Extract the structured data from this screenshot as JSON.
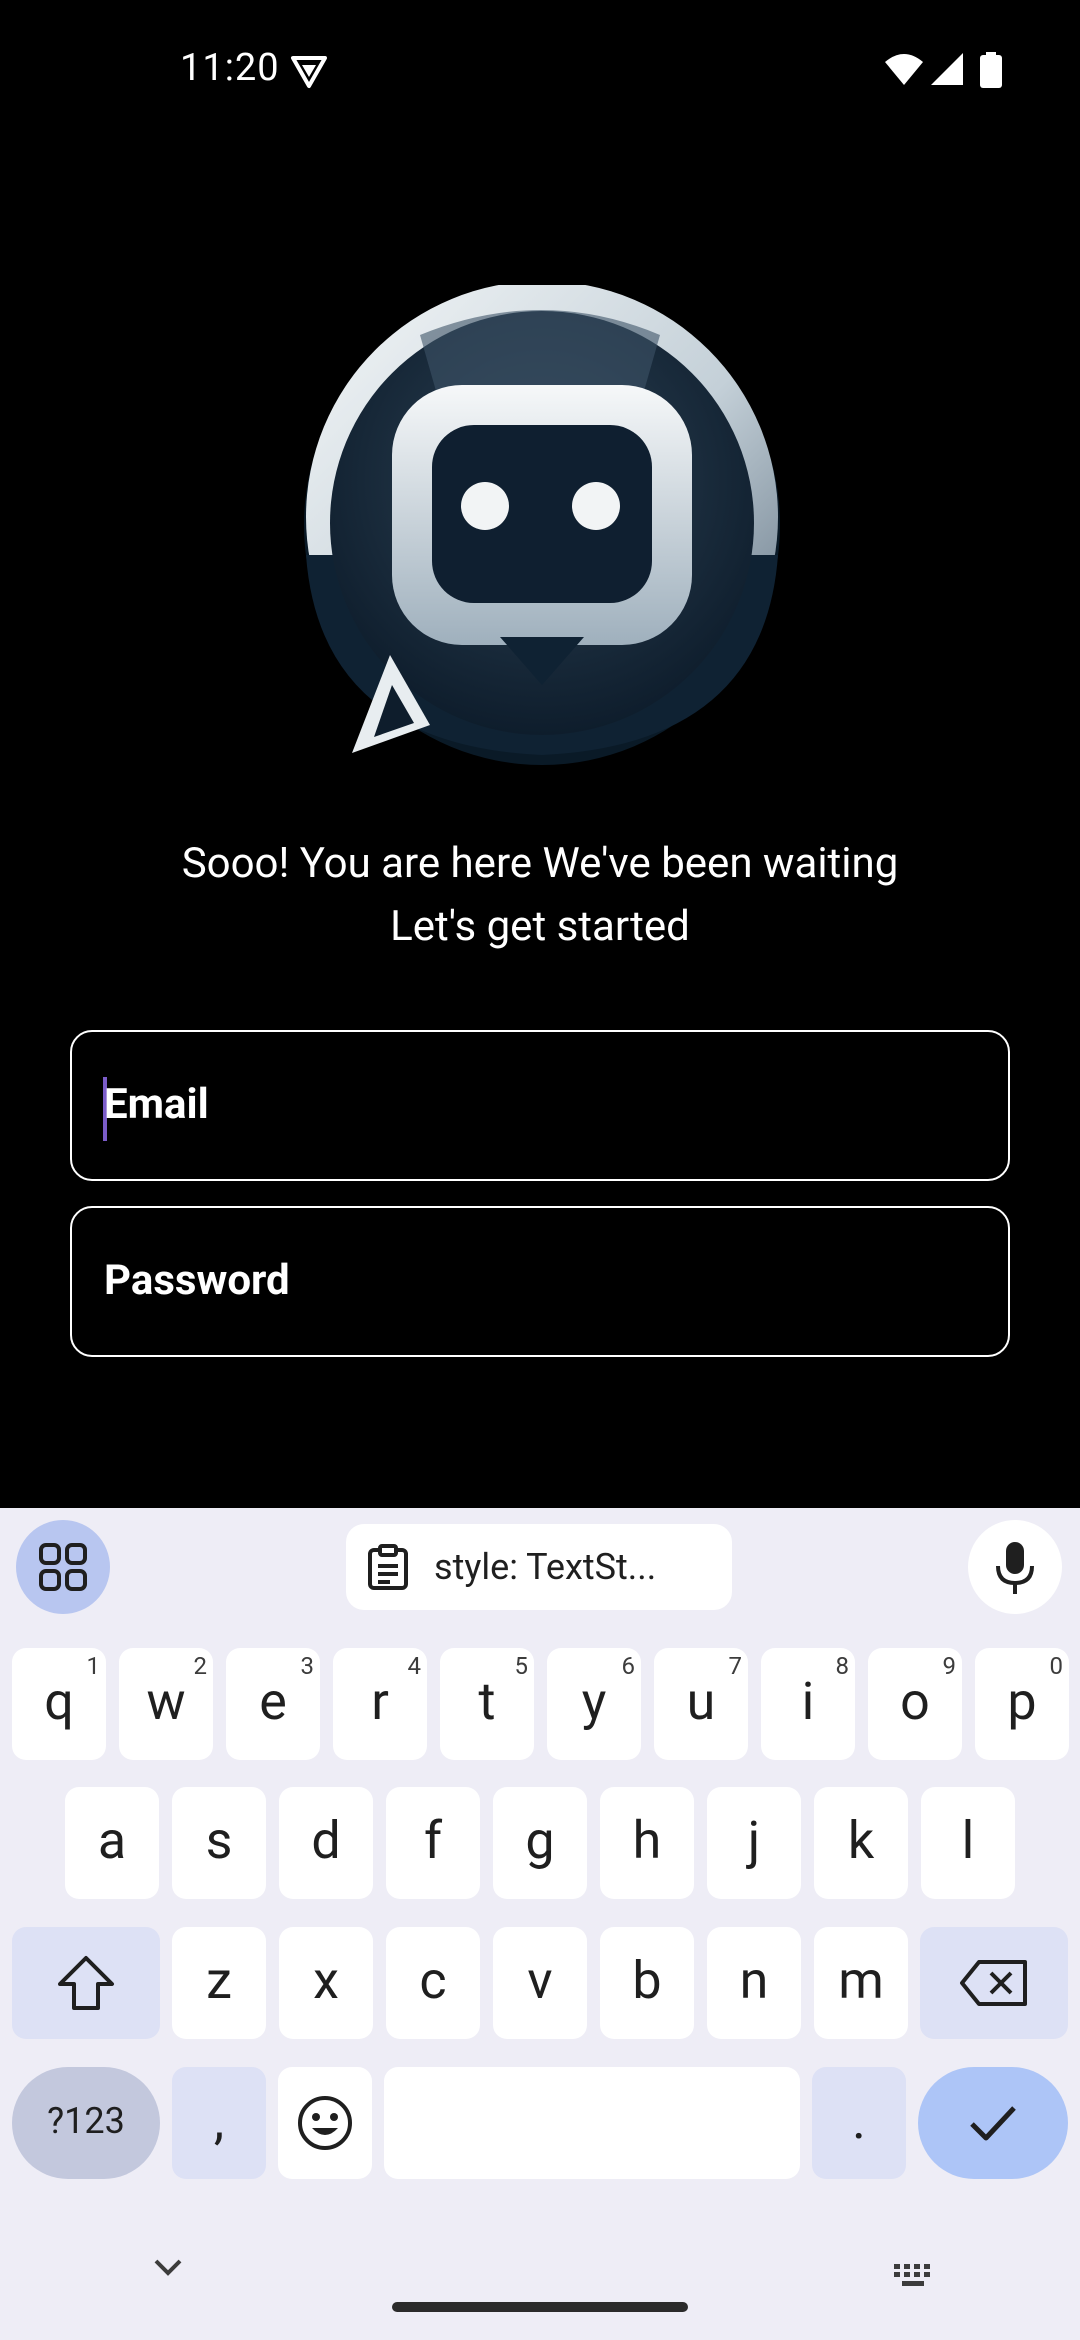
{
  "status_bar": {
    "time": "11:20",
    "icons": [
      "vpn-shield-icon",
      "wifi-icon",
      "cellular-signal-icon",
      "battery-icon"
    ]
  },
  "app": {
    "logo": "chat-bot-logo",
    "welcome_line1": "Sooo! You are here We've been waiting",
    "welcome_line2": "Let's get started"
  },
  "form": {
    "email_label": "Email",
    "password_label": "Password",
    "focus_color": "#7b5cc9"
  },
  "keyboard": {
    "clipboard_suggestion": "style: TextSt...",
    "row1": [
      {
        "key": "q",
        "hint": "1"
      },
      {
        "key": "w",
        "hint": "2"
      },
      {
        "key": "e",
        "hint": "3"
      },
      {
        "key": "r",
        "hint": "4"
      },
      {
        "key": "t",
        "hint": "5"
      },
      {
        "key": "y",
        "hint": "6"
      },
      {
        "key": "u",
        "hint": "7"
      },
      {
        "key": "i",
        "hint": "8"
      },
      {
        "key": "o",
        "hint": "9"
      },
      {
        "key": "p",
        "hint": "0"
      }
    ],
    "row2": [
      "a",
      "s",
      "d",
      "f",
      "g",
      "h",
      "j",
      "k",
      "l"
    ],
    "row3": [
      "z",
      "x",
      "c",
      "v",
      "b",
      "n",
      "m"
    ],
    "symbols_label": "?123",
    "comma": ",",
    "period": ".",
    "icons": [
      "apps-grid-icon",
      "clipboard-icon",
      "mic-icon",
      "shift-icon",
      "backspace-icon",
      "emoji-icon",
      "check-icon"
    ]
  },
  "nav": {
    "icons": [
      "chevron-down-icon",
      "keyboard-switch-icon"
    ]
  },
  "colors": {
    "background": "#000000",
    "keyboard_bg": "#eeedf6",
    "accent_key": "#adc5f7",
    "special_key": "#dde1f5"
  }
}
